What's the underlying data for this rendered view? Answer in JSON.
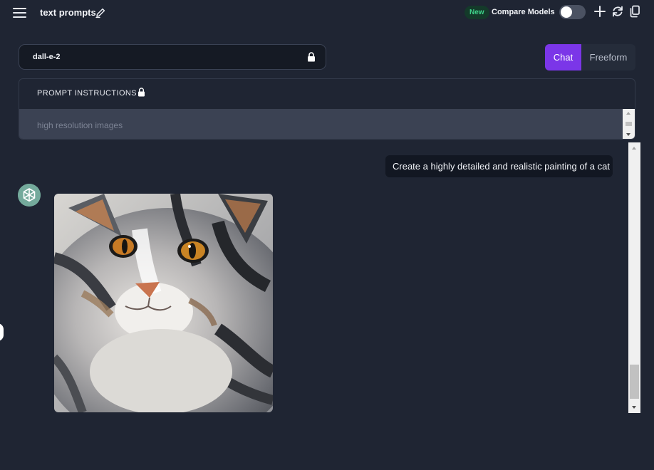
{
  "header": {
    "title": "text prompts",
    "new_badge": "New",
    "compare_models_label": "Compare Models",
    "compare_models_enabled": false,
    "icons": [
      "menu-icon",
      "edit-icon",
      "plus-icon",
      "refresh-icon",
      "copy-icon"
    ]
  },
  "model_selector": {
    "value": "dall-e-2",
    "locked": true
  },
  "mode_toggle": {
    "options": [
      "Chat",
      "Freeform"
    ],
    "selected": "Chat"
  },
  "prompt_instructions": {
    "heading": "PROMPT INSTRUCTIONS",
    "locked": true,
    "value": "high resolution images"
  },
  "chat": {
    "messages": [
      {
        "role": "user",
        "text": "Create a highly detailed and realistic painting of a cat"
      },
      {
        "role": "assistant",
        "type": "image",
        "content": "painting-of-a-fluffy-grey-tabby-cat"
      }
    ]
  },
  "colors": {
    "background": "#1f2533",
    "accent": "#7b36e8",
    "badge_bg": "#143a2a",
    "badge_text": "#3fd38a",
    "avatar": "#74aa9c"
  }
}
